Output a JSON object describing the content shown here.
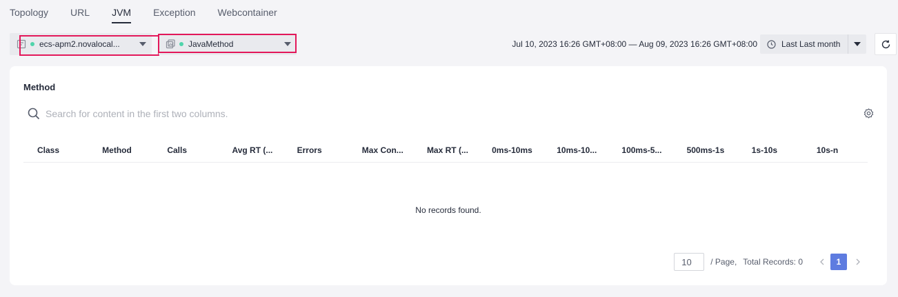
{
  "tabs": [
    "Topology",
    "URL",
    "JVM",
    "Exception",
    "Webcontainer"
  ],
  "active_tab": "JVM",
  "toolbar": {
    "app_select": "ecs-apm2.novalocal...",
    "component_select": "JavaMethod",
    "status_dot_color": "#50d4ab",
    "highlight_color": "#e3175a",
    "time_range": "Jul 10, 2023 16:26 GMT+08:00 — Aug 09, 2023 16:26 GMT+08:00",
    "range_label": "Last Last month"
  },
  "card": {
    "title": "Method",
    "search_placeholder": "Search for content in the first two columns.",
    "columns": [
      "Class",
      "Method",
      "Calls",
      "Avg RT (...",
      "Errors",
      "Max Con...",
      "Max RT (...",
      "0ms-10ms",
      "10ms-10...",
      "100ms-5...",
      "500ms-1s",
      "1s-10s",
      "10s-n"
    ],
    "empty_text": "No records found."
  },
  "pagination": {
    "page_size": "10",
    "per_page_label": "/ Page,",
    "total_label": "Total Records: 0",
    "current_page": "1",
    "accent": "#5e7ce0"
  }
}
